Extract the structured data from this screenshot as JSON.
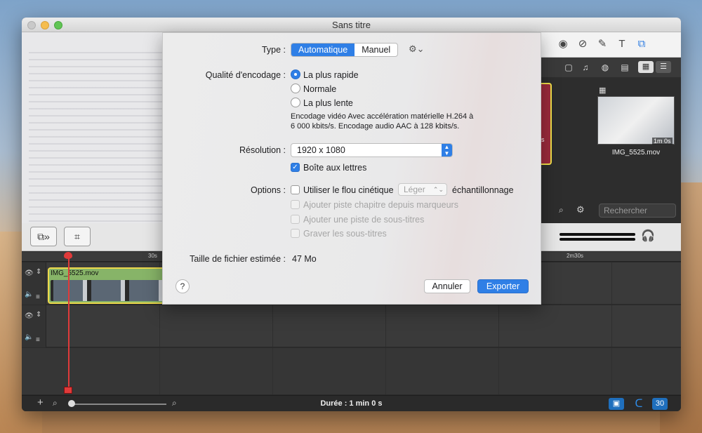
{
  "window": {
    "title": "Sans titre"
  },
  "dialog": {
    "type_label": "Type :",
    "type_options": [
      "Automatique",
      "Manuel"
    ],
    "quality_label": "Qualité d'encodage :",
    "quality_options": [
      "La plus rapide",
      "Normale",
      "La plus lente"
    ],
    "quality_selected": "La plus rapide",
    "description_line1": "Encodage vidéo Avec accélération matérielle H.264 à",
    "description_line2": "6 000 kbits/s.  Encodage audio AAC à 128 kbits/s.",
    "resolution_label": "Résolution :",
    "resolution_value": "1920 x 1080",
    "letterbox_label": "Boîte aux lettres",
    "letterbox_checked": true,
    "options_label": "Options :",
    "motion_blur_label": "Utiliser le flou cinétique",
    "motion_blur_level": "Léger",
    "sampling_label": "échantillonnage",
    "chapter_label": "Ajouter piste chapitre depuis marqueurs",
    "subtitle_track_label": "Ajouter une piste de sous-titres",
    "burn_subtitles_label": "Graver les sous-titres",
    "filesize_label": "Taille de fichier estimée :",
    "filesize_value": "47 Mo",
    "help_label": "?",
    "cancel_label": "Annuler",
    "export_label": "Exporter"
  },
  "media": {
    "clip_duration": "1m 0s",
    "clip_name": "IMG_5525.mov",
    "search_placeholder": "Rechercher",
    "partial_duration": "s"
  },
  "timeline": {
    "ruler_labels": [
      "30s",
      "2m30s"
    ],
    "clip_title": "IMG_5525.mov"
  },
  "status": {
    "duration_text": "Durée : 1 min 0 s",
    "fps_badge": "30"
  },
  "colors": {
    "accent": "#2f7fe6",
    "clip_green": "#87b468",
    "selection_yellow": "#ecd94b",
    "playhead_red": "#e03a3a"
  }
}
